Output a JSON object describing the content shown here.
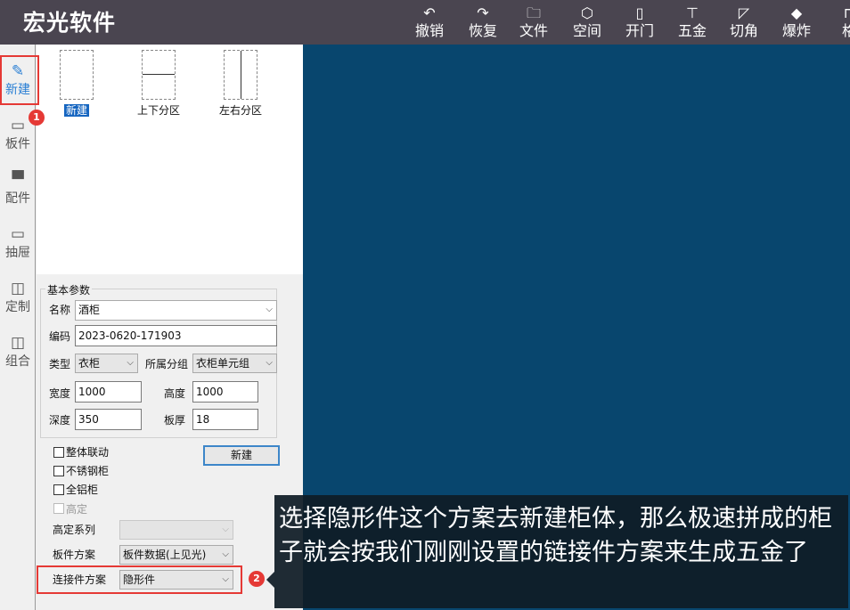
{
  "app": {
    "title": "宏光软件"
  },
  "toolbar": [
    {
      "label": "撤销",
      "icon": "undo-icon",
      "glyph": "↶"
    },
    {
      "label": "恢复",
      "icon": "redo-icon",
      "glyph": "↷"
    },
    {
      "label": "文件",
      "icon": "folder-icon",
      "glyph": "🗀"
    },
    {
      "label": "空间",
      "icon": "cube-icon",
      "glyph": "⬡"
    },
    {
      "label": "开门",
      "icon": "door-icon",
      "glyph": "▯"
    },
    {
      "label": "五金",
      "icon": "hardware-icon",
      "glyph": "⊤"
    },
    {
      "label": "切角",
      "icon": "corner-cut-icon",
      "glyph": "◸"
    },
    {
      "label": "爆炸",
      "icon": "explode-icon",
      "glyph": "◆"
    },
    {
      "label": "格",
      "icon": "grid-icon",
      "glyph": "⊓"
    }
  ],
  "sidebar": [
    {
      "label": "新建",
      "icon": "edit-icon",
      "glyph": "✎",
      "active": true
    },
    {
      "label": "板件",
      "icon": "board-icon",
      "glyph": "▭"
    },
    {
      "label": "配件",
      "icon": "fitting-icon",
      "glyph": "▀"
    },
    {
      "label": "抽屉",
      "icon": "drawer-icon",
      "glyph": "▭"
    },
    {
      "label": "定制",
      "icon": "custom-icon",
      "glyph": "◫"
    },
    {
      "label": "组合",
      "icon": "combine-icon",
      "glyph": "◫"
    }
  ],
  "templates": [
    {
      "label": "新建",
      "selected": true,
      "divider": "none"
    },
    {
      "label": "上下分区",
      "divider": "horizontal"
    },
    {
      "label": "左右分区",
      "divider": "vertical"
    }
  ],
  "params": {
    "group_title": "基本参数",
    "name_label": "名称",
    "name_value": "酒柜",
    "code_label": "编码",
    "code_value": "2023-0620-171903",
    "type_label": "类型",
    "type_value": "衣柜",
    "group_label": "所属分组",
    "group_value": "衣柜单元组",
    "width_label": "宽度",
    "width_value": "1000",
    "height_label": "高度",
    "height_value": "1000",
    "depth_label": "深度",
    "depth_value": "350",
    "thickness_label": "板厚",
    "thickness_value": "18"
  },
  "options": {
    "linkage_label": "整体联动",
    "stainless_label": "不锈钢柜",
    "aluminum_label": "全铝柜",
    "custom_label": "高定",
    "custom_series_label": "高定系列",
    "custom_series_value": "",
    "board_scheme_label": "板件方案",
    "board_scheme_value": "板件数据(上见光)",
    "connector_label": "连接件方案",
    "connector_value": "隐形件",
    "new_button": "新建"
  },
  "annotations": {
    "badge1": "1",
    "badge2": "2"
  },
  "caption": "选择隐形件这个方案去新建柜体，那么极速拼成的柜子就会按我们刚刚设置的链接件方案来生成五金了",
  "colors": {
    "topbar": "#4a4550",
    "canvas": "#08466e",
    "accent": "#2a7fd4",
    "highlight": "#e53935"
  }
}
